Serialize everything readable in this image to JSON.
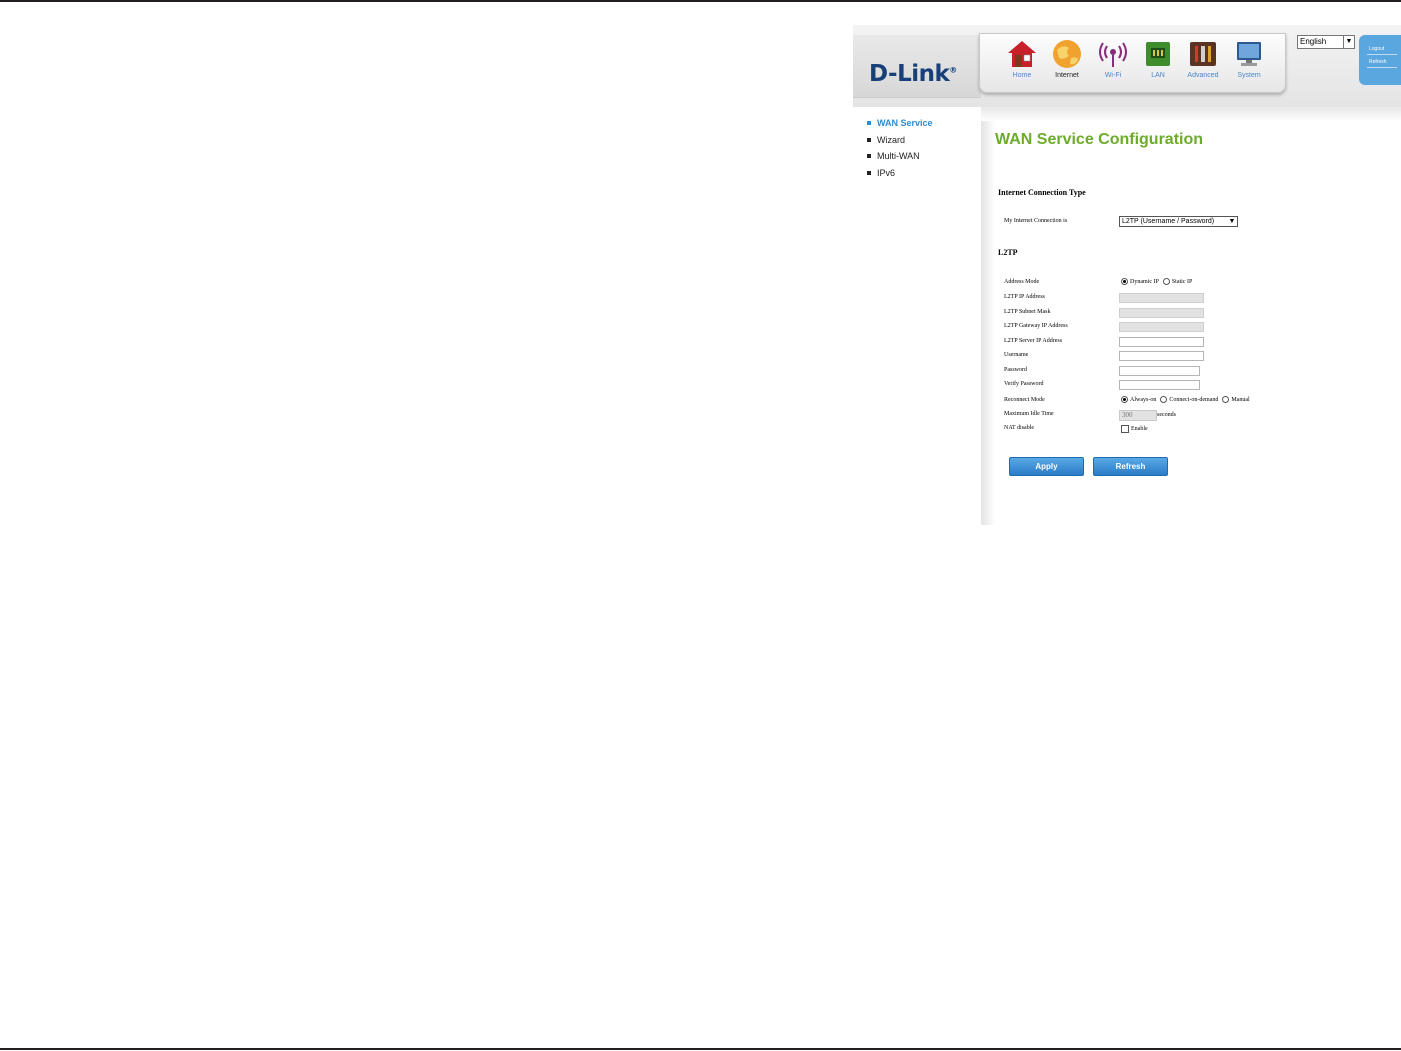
{
  "header": {
    "logo": "D-Link",
    "language": "English",
    "nav": [
      {
        "label": "Home",
        "icon": "home-icon"
      },
      {
        "label": "Internet",
        "icon": "globe-icon"
      },
      {
        "label": "Wi-Fi",
        "icon": "wifi-icon"
      },
      {
        "label": "LAN",
        "icon": "lan-icon"
      },
      {
        "label": "Advanced",
        "icon": "tools-icon"
      },
      {
        "label": "System",
        "icon": "monitor-icon"
      }
    ],
    "active_nav": "Internet",
    "quick": {
      "logout": "Logout",
      "refresh": "Refresh"
    }
  },
  "sidebar": {
    "items": [
      {
        "label": "WAN Service",
        "active": true
      },
      {
        "label": "Wizard",
        "active": false
      },
      {
        "label": "Multi-WAN",
        "active": false
      },
      {
        "label": "IPv6",
        "active": false
      }
    ]
  },
  "main": {
    "title": "WAN Service Configuration",
    "section_connection": "Internet Connection Type",
    "connection_label": "My Internet Connection is",
    "connection_value": "L2TP (Username / Password)",
    "section_l2tp": "L2TP",
    "address_mode": {
      "label": "Address Mode",
      "options": [
        "Dynamic IP",
        "Static IP"
      ],
      "selected": "Dynamic IP"
    },
    "fields": {
      "ip_address": "L2TP IP Address",
      "subnet_mask": "L2TP Subnet Mask",
      "gateway": "L2TP Gateway IP Address",
      "server": "L2TP Server IP Address",
      "username": "Username",
      "password": "Password",
      "verify_password": "Verify Password"
    },
    "reconnect": {
      "label": "Reconnect Mode",
      "options": [
        "Always-on",
        "Connect-on-demand",
        "Manual"
      ],
      "selected": "Always-on"
    },
    "idle": {
      "label": "Maximum Idle Time",
      "value": "300",
      "unit": "seconds"
    },
    "nat": {
      "label": "NAT disable",
      "option": "Enable",
      "checked": false
    },
    "buttons": {
      "apply": "Apply",
      "refresh": "Refresh"
    }
  },
  "colors": {
    "title_green": "#6cab2c",
    "accent_blue": "#2e8cd0",
    "button_blue": "#2a7bc7",
    "logo_navy": "#173f7a"
  }
}
